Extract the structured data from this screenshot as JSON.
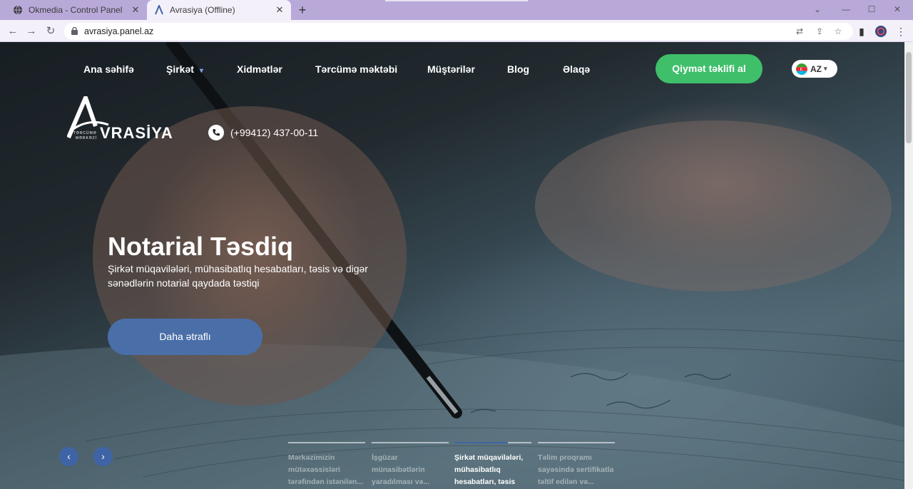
{
  "browser": {
    "tabs": [
      {
        "title": "Okmedia - Control Panel",
        "icon": "globe-icon"
      },
      {
        "title": "Avrasiya (Offline)",
        "icon": "avrasiya-favicon"
      }
    ],
    "url": "avrasiya.panel.az"
  },
  "nav": {
    "items": [
      "Ana səhifə",
      "Şirkət",
      "Xidmətlər",
      "Tərcümə məktəbi",
      "Müştərilər",
      "Blog",
      "Əlaqə"
    ],
    "cta_label": "Qiymət təklifi al",
    "language": "AZ"
  },
  "logo": {
    "text": "VRASİYA",
    "tagline_1": "TƏRCÜMƏ",
    "tagline_2": "MƏRKƏZİ"
  },
  "phone": "(+99412) 437-00-11",
  "hero": {
    "title": "Notarial Təsdiq",
    "subtitle": "Şirkət müqavilələri, mühasibatlıq hesabatları, təsis və digər sənədlərin notarial qaydada təstiqi",
    "button": "Daha ətraflı"
  },
  "slider": {
    "tabs": [
      "Mərkəzimizin mütəxəssisləri tərəfindən istənilən...",
      "İşgüzar münasibətlərin yaradılması və...",
      "Şirkət müqavilələri, mühasibatlıq hesabatları, təsis və...",
      "Təlim proqramı sayəsində sertifikatla təltif edilən və..."
    ],
    "active_index": 2,
    "active_progress": 0.69
  },
  "colors": {
    "cta": "#3fbf6a",
    "primary_blue": "#4a6fa8",
    "tabstrip": "#b8a9d9"
  }
}
